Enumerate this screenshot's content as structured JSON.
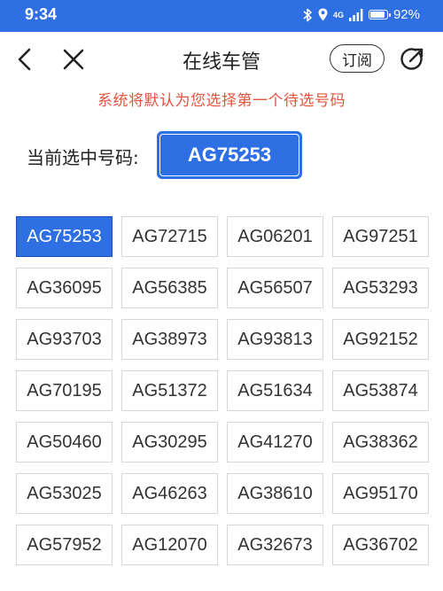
{
  "status_bar": {
    "time": "9:34",
    "network": "4G",
    "battery": "92%",
    "battery_level": 0.92,
    "icons": [
      "bluetooth-icon",
      "location-icon",
      "signal-icon",
      "battery-icon"
    ]
  },
  "nav": {
    "title": "在线车管",
    "subscribe_label": "订阅",
    "icons": [
      "back-icon",
      "close-icon",
      "share-icon"
    ]
  },
  "notice": "系统将默认为您选择第一个待选号码",
  "selected": {
    "label": "当前选中号码:",
    "plate": "AG75253"
  },
  "colors": {
    "primary": "#2f6fe4",
    "notice": "#e2553f"
  },
  "plates": [
    "AG75253",
    "AG72715",
    "AG06201",
    "AG97251",
    "AG36095",
    "AG56385",
    "AG56507",
    "AG53293",
    "AG93703",
    "AG38973",
    "AG93813",
    "AG92152",
    "AG70195",
    "AG51372",
    "AG51634",
    "AG53874",
    "AG50460",
    "AG30295",
    "AG41270",
    "AG38362",
    "AG53025",
    "AG46263",
    "AG38610",
    "AG95170",
    "AG57952",
    "AG12070",
    "AG32673",
    "AG36702"
  ],
  "selected_index": 0
}
